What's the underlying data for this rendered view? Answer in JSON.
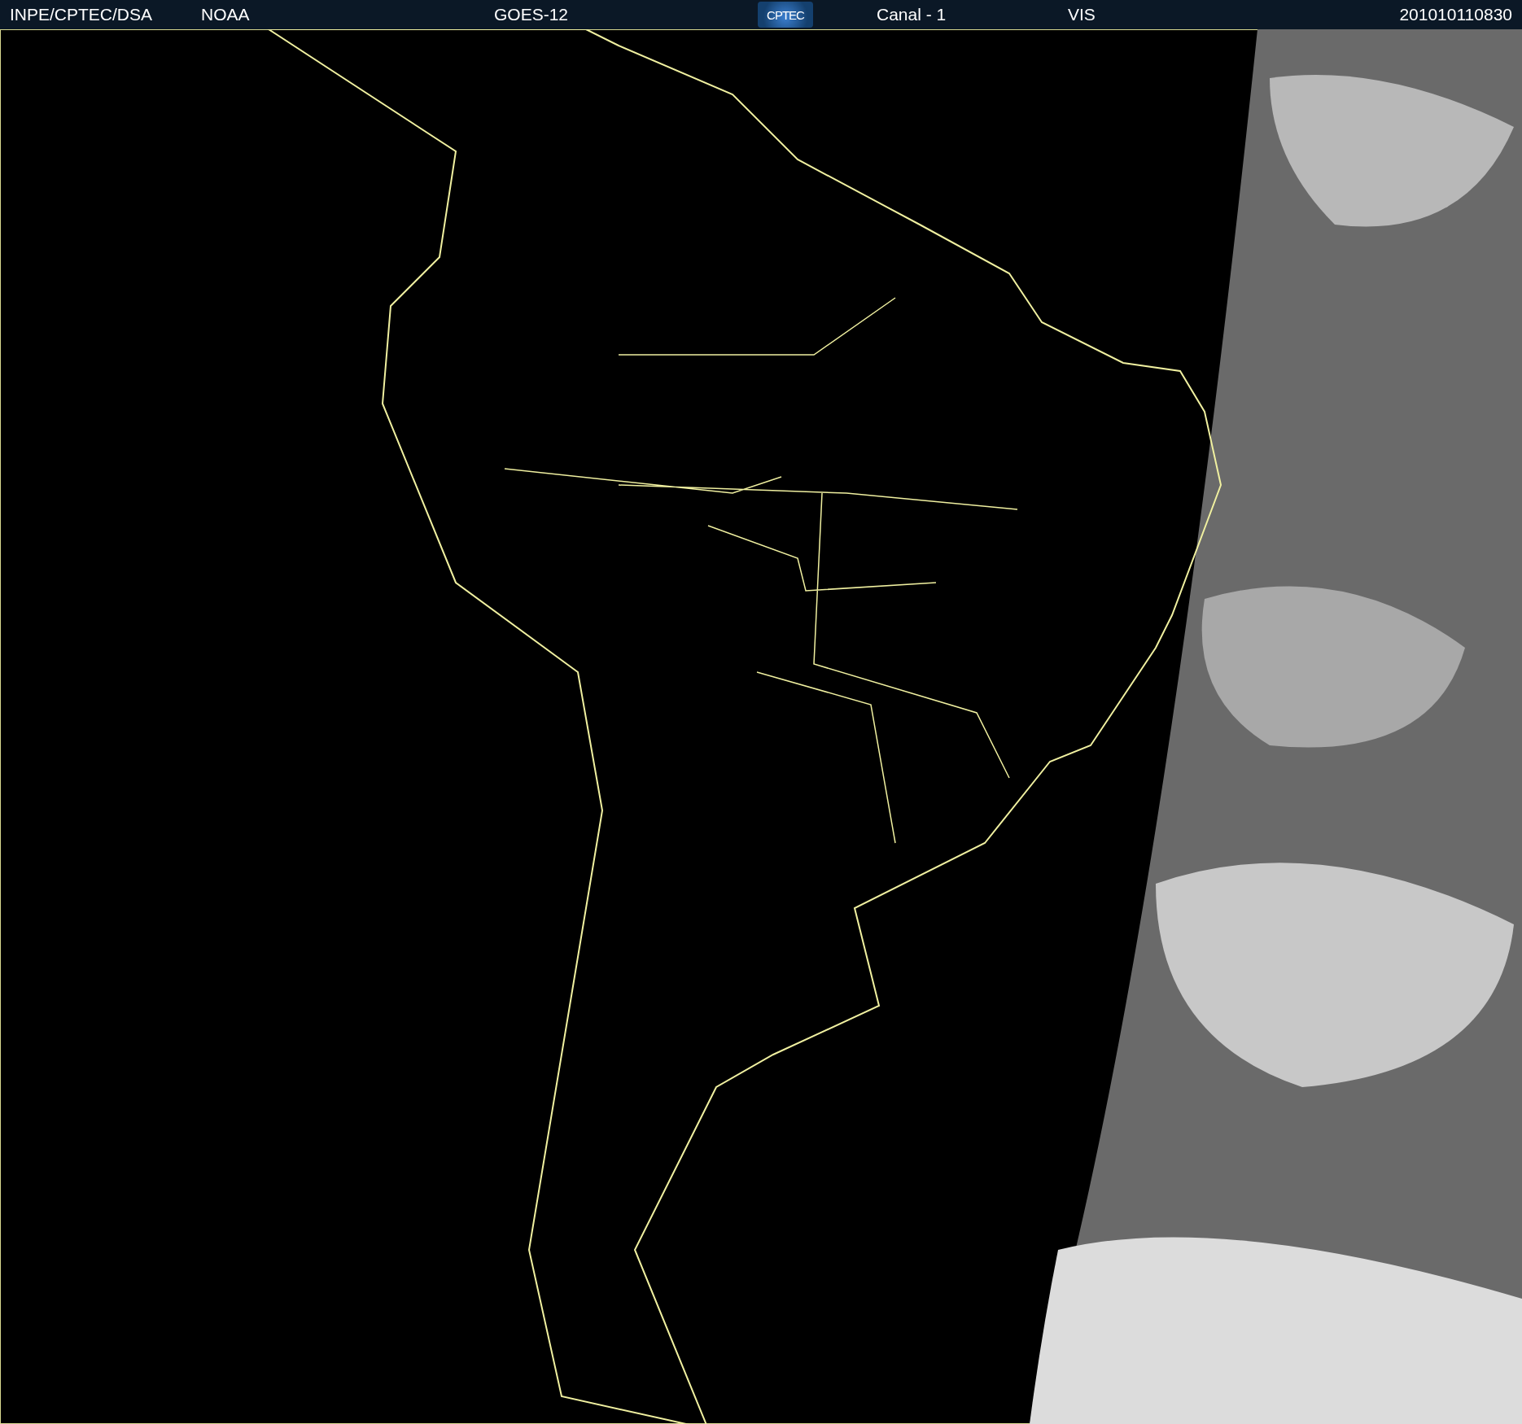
{
  "header": {
    "agency": "INPE/CPTEC/DSA",
    "source": "NOAA",
    "satellite": "GOES-12",
    "logo": "CPTEC",
    "channel": "Canal - 1",
    "band": "VIS",
    "timestamp": "201010110830"
  }
}
